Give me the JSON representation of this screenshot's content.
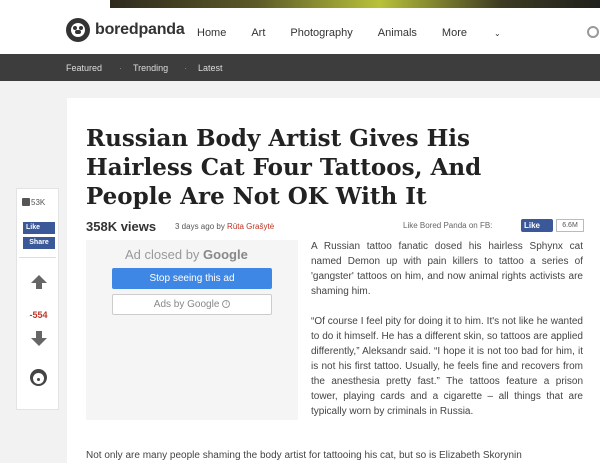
{
  "brand": {
    "name": "boredpanda"
  },
  "nav": {
    "items": [
      "Home",
      "Art",
      "Photography",
      "Animals",
      "More"
    ]
  },
  "subnav": {
    "items": [
      "Featured",
      "Trending",
      "Latest"
    ]
  },
  "article": {
    "title": "Russian Body Artist Gives His Hairless Cat Four Tattoos, And People Are Not OK With It",
    "views": "358K views",
    "posted_prefix": "3 days ago by ",
    "author": "Rūta Grašytė",
    "fb_prompt": "Like Bored Panda on FB:",
    "fb_like": "Like",
    "fb_count": "6.6M",
    "paragraphs": [
      "A Russian tattoo fanatic dosed his hairless Sphynx cat named Demon up with pain killers to tattoo a series of 'gangster' tattoos on him, and now animal rights activists are shaming him.",
      "“Of course I feel pity for doing it to him. It's not like he wanted to do it himself. He has a different skin, so tattoos are applied differently,” Aleksandr said. “I hope it is not too bad for him, it is not his first tattoo. Usually, he feels fine and recovers from the anesthesia pretty fast.” The tattoos feature a prison tower, playing cards and a cigarette – all things that are typically worn by criminals in Russia.",
      "Not only are many people shaming the body artist for tattooing his cat, but so is Elizabeth Skorynin"
    ]
  },
  "ad": {
    "closed_prefix": "Ad closed by ",
    "closed_brand": "Google",
    "stop_label": "Stop seeing this ad",
    "ads_by_label": "Ads by Google"
  },
  "share": {
    "likes": "53K",
    "fb_like": "Like",
    "share_label": "Share",
    "score": "-554"
  },
  "icons": [
    "panda-logo-icon",
    "search-icon",
    "thumbs-up-icon",
    "facebook-icon",
    "upvote-arrow-icon",
    "downvote-arrow-icon",
    "panda-icon",
    "info-icon"
  ],
  "colors": {
    "fb_blue": "#3b5998",
    "ad_blue": "#3f87e4",
    "score_red": "#c0392b",
    "subnav_bg": "#3d3d3d"
  }
}
